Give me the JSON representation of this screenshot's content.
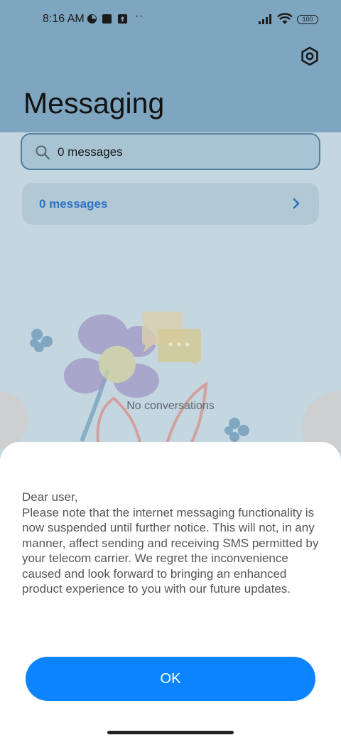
{
  "status_bar": {
    "time": "8:16 AM",
    "battery": "100"
  },
  "header": {
    "title": "Messaging",
    "settings_icon": "gear-icon"
  },
  "search": {
    "value": "0 messages"
  },
  "message_card": {
    "label": "0 messages"
  },
  "empty_state": {
    "text": "No conversations"
  },
  "dialog": {
    "message": "Dear user,\nPlease note that the internet messaging functionality is now suspended until further notice. This will not, in any manner, affect sending and receiving SMS permitted by your telecom carrier. We regret the inconvenience caused and look forward to bringing an enhanced product experience to you with our future updates.",
    "ok_label": "OK"
  },
  "colors": {
    "header": "#7fa6c0",
    "accent": "#0c84ff",
    "link": "#2c73c2"
  }
}
